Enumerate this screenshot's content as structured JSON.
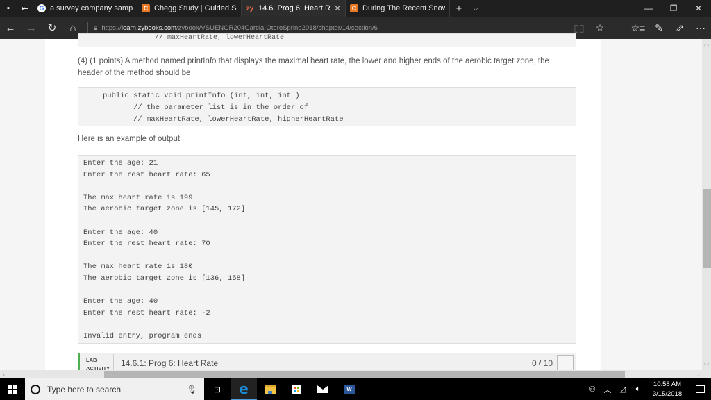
{
  "browser": {
    "tabs": [
      {
        "favicon": "google-favicon",
        "favicon_text": "G",
        "title": "a survey company sampled",
        "active": false
      },
      {
        "favicon": "chegg-favicon",
        "favicon_text": "C",
        "title": "Chegg Study | Guided Solut",
        "active": false
      },
      {
        "favicon": "zybooks-favicon",
        "favicon_text": "zy",
        "title": "14.6. Prog 6: Heart Rate",
        "active": true
      },
      {
        "favicon": "chegg-favicon",
        "favicon_text": "C",
        "title": "During The Recent Snowing",
        "active": false
      }
    ],
    "new_tab": "+",
    "tab_menu": "⌵",
    "window_controls": {
      "minimize": "—",
      "restore": "❐",
      "close": "✕"
    },
    "nav": {
      "back": "←",
      "forward": "→",
      "refresh": "↻",
      "home": "⌂"
    },
    "url": {
      "scheme": "https://",
      "host": "learn.zybooks.com",
      "path": "/zybook/VSUENGR204Garcia-OteroSpring2018/chapter/14/section/6"
    },
    "toolbar_icons": {
      "reading_view": "📖",
      "favorite": "☆",
      "favorites_hub": "☰",
      "notes": "✍",
      "share": "⇪",
      "more": "···"
    }
  },
  "page": {
    "previous_code_fragment": "//  maxHeartRate, lowerHeartRate",
    "item4_text": "(4) (1 points) A method named printInfo that displays the maximal heart rate, the lower and higher ends of the aerobic target zone, the header of the method should be",
    "method_header_code": [
      "public static void printInfo (int, int, int )",
      "       // the parameter list is in the order of",
      "       // maxHeartRate, lowerHeartRate, higherHeartRate"
    ],
    "example_label": "Here is an example of output",
    "example_output": [
      "Enter the age: 21",
      "Enter the rest heart rate: 65",
      "",
      "The max heart rate is 199",
      "The aerobic target zone is [145, 172]",
      "",
      "Enter the age: 40",
      "Enter the rest heart rate: 70",
      "",
      "The max heart rate is 180",
      "The aerobic target zone is [136, 158]",
      "",
      "Enter the age: 40",
      "Enter the rest heart rate: -2",
      "",
      "Invalid entry, program ends"
    ],
    "lab_activity": {
      "label": "LAB ACTIVITY",
      "title": "14.6.1: Prog 6: Heart Rate",
      "score": "0 / 10",
      "accent_color": "#4caf50"
    }
  },
  "taskbar": {
    "search_placeholder": "Type here to search",
    "apps": [
      "task-view",
      "edge",
      "file-explorer",
      "store",
      "mail",
      "word"
    ],
    "tray": {
      "people": "ጸ",
      "chevron": "^",
      "wifi": "◢",
      "volume": "🔇"
    },
    "time": "10:58 AM",
    "date": "3/15/2018"
  }
}
